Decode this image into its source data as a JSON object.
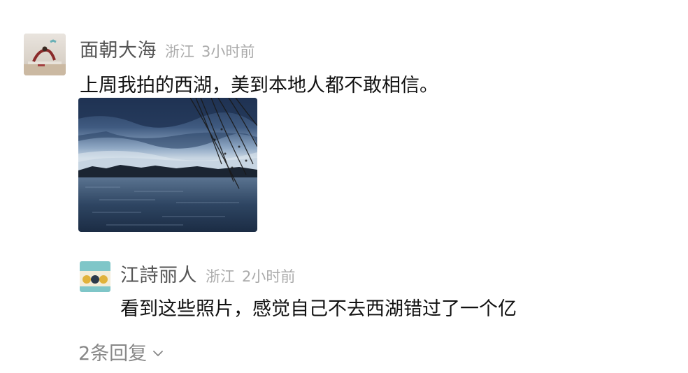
{
  "comment": {
    "username": "面朝大海",
    "location": "浙江",
    "time": "3小时前",
    "text": "上周我拍的西湖，美到本地人都不敢相信。",
    "photo_icon": "photo-west-lake"
  },
  "reply": {
    "username": "江詩丽人",
    "location": "浙江",
    "time": "2小时前",
    "text": "看到这些照片，感觉自己不去西湖错过了一个亿"
  },
  "more_replies": {
    "label": "2条回复",
    "icon": "chevron-down-icon"
  },
  "colors": {
    "name": "#555555",
    "meta": "#aaaaaa",
    "text": "#111111",
    "more": "#888888"
  }
}
